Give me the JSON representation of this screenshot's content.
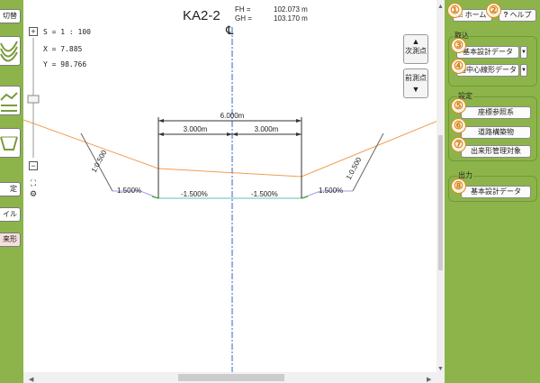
{
  "left_toolbar": {
    "buttons": [
      "切替",
      "",
      "",
      "",
      "定",
      "イル",
      "来形"
    ]
  },
  "header": {
    "title": "KA2-2",
    "fh_label": "FH =",
    "fh_value": "102.073 m",
    "gh_label": "GH =",
    "gh_value": "103.170 m",
    "centerline_symbol": "℄"
  },
  "info": {
    "scale": "S = 1 : 100",
    "x": "X = 7.885",
    "y": "Y = 98.766"
  },
  "nav": {
    "next_label": "次測点",
    "prev_label": "前測点"
  },
  "zoom": {
    "plus": "+",
    "minus": "−",
    "fit": "⛶",
    "settings": "⚙",
    "level_fraction": 0.3
  },
  "section": {
    "total_width": "6.000m",
    "left_width": "3.000m",
    "right_width": "3.000m",
    "slope_left": "1:0.500",
    "slope_right": "1:0.500",
    "grade_outer_left": "1.500%",
    "grade_inner_left": "-1.500%",
    "grade_inner_right": "-1.500%",
    "grade_outer_right": "1.500%"
  },
  "right_panel": {
    "home": "ホーム",
    "help": "ヘルプ",
    "groups": {
      "import": "取込",
      "settings": "設定",
      "output": "出力"
    },
    "buttons": {
      "basic_design": "基本設計データ",
      "road_center": "路中心線形データ",
      "coord_ref": "座標参照系",
      "road_structure": "道路構築物",
      "quality_target": "出来形管理対象",
      "output_basic": "基本設計データ"
    },
    "badges": [
      "①",
      "②",
      "③",
      "④",
      "⑤",
      "⑥",
      "⑦",
      "⑧"
    ]
  },
  "colors": {
    "panel_green": "#8db44b",
    "badge_orange": "#d97b0a",
    "terrain_orange": "#f39c50",
    "centerline_blue": "#2c66c8"
  }
}
